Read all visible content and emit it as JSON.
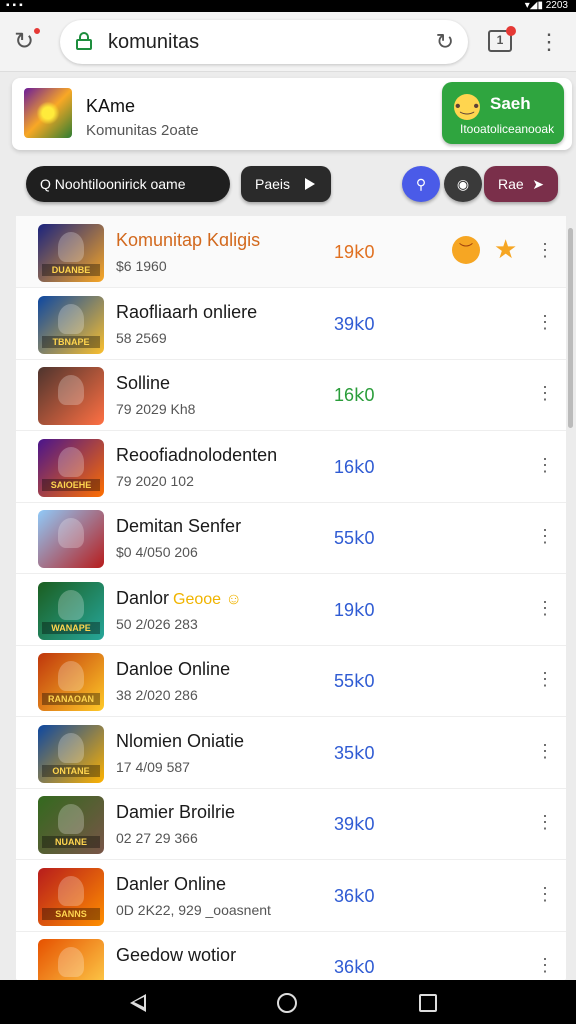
{
  "status_bar": {
    "left_icons": "▪▪▪",
    "right_icons": "▾◢▮ 2203"
  },
  "browser": {
    "url": "komunitas",
    "back_icon": "back-arrow-icon",
    "tab_count": "1"
  },
  "header": {
    "title": "KAme",
    "subtitle": "Komunitas 2oate",
    "search_label": "Saeh",
    "search_sub": "Itooatoliceanooak"
  },
  "toolbar": {
    "search_text": "Q Noohtiloonirick oame",
    "play_label": "Paeis",
    "rise_label": "Rae"
  },
  "games": [
    {
      "name": "Komunitap Kɑligis",
      "meta": "$6 1960",
      "count": "19𝗄0",
      "count_color": "#e07020",
      "name_color": "#d2691e",
      "thumb": [
        "#1a237e",
        "#f9a825"
      ],
      "cap": "DUANBE",
      "extras": true
    },
    {
      "name": "Raofliaarh onliere",
      "meta": "58 2569",
      "count": "39𝗄0",
      "count_color": "#2f5bd3",
      "thumb": [
        "#0d47a1",
        "#fbc02d"
      ],
      "cap": "TBNAPE"
    },
    {
      "name": "Solline",
      "meta": "79 2029 Kh8",
      "count": "16𝗄0",
      "count_color": "#2a9d3a",
      "thumb": [
        "#4e342e",
        "#ff7043"
      ],
      "cap": ""
    },
    {
      "name": "Reoofiadnolodenten",
      "meta": "79 2020 102",
      "count": "16𝗄0",
      "count_color": "#2f5bd3",
      "thumb": [
        "#4a148c",
        "#ff6f00"
      ],
      "cap": "SAIOEHE"
    },
    {
      "name": "Demitan Senfer",
      "meta": "$0 4/050 206",
      "count": "55𝗄0",
      "count_color": "#2f5bd3",
      "thumb": [
        "#90caf9",
        "#b71c1c"
      ],
      "cap": ""
    },
    {
      "name": "Danlor",
      "badge": "Geooe",
      "meta": "50 2/026 283",
      "count": "19𝗄0",
      "count_color": "#2f5bd3",
      "thumb": [
        "#1b5e20",
        "#26a69a"
      ],
      "cap": "WANAPE"
    },
    {
      "name": "Danloe Online",
      "meta": "38 2/020 286",
      "count": "55𝗄0",
      "count_color": "#2f5bd3",
      "thumb": [
        "#bf360c",
        "#ffca28"
      ],
      "cap": "RANAOAN"
    },
    {
      "name": "Nlomien Oniatie",
      "meta": "17 4/09 587",
      "count": "35𝗄0",
      "count_color": "#2f5bd3",
      "thumb": [
        "#0d47a1",
        "#ffb300"
      ],
      "cap": "ONTANE"
    },
    {
      "name": "Damier Broilrie",
      "meta": "02 27 29 366",
      "count": "39𝗄0",
      "count_color": "#2f5bd3",
      "thumb": [
        "#33691e",
        "#795548"
      ],
      "cap": "NUANE"
    },
    {
      "name": "Danler Online",
      "meta": "0D 2K22, 929 _ooasnent",
      "count": "36𝗄0",
      "count_color": "#2f5bd3",
      "thumb": [
        "#b71c1c",
        "#ff8f00"
      ],
      "cap": "SANNS"
    },
    {
      "name": "Geedow wotior",
      "meta": "",
      "count": "36𝗄0",
      "count_color": "#2f5bd3",
      "thumb": [
        "#e65100",
        "#ffd54f"
      ],
      "cap": ""
    }
  ]
}
